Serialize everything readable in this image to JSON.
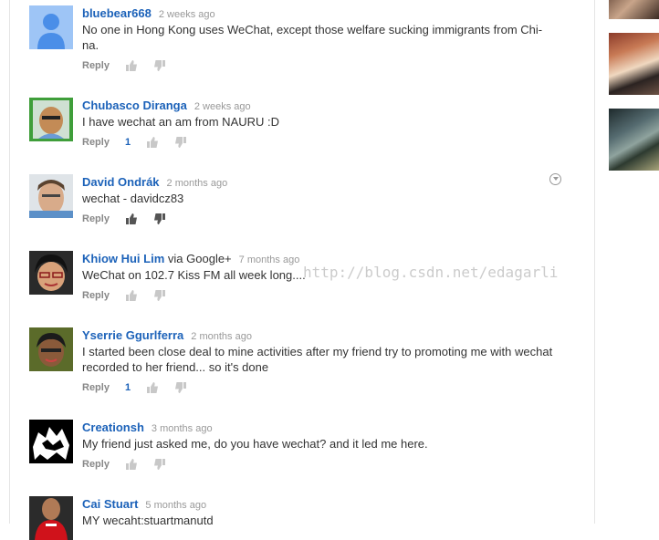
{
  "comments": [
    {
      "author": "bluebear668",
      "via": "",
      "time": "2 weeks ago",
      "text": "No one in Hong Kong uses WeChat, except those welfare sucking immigrants from Chi-na.",
      "reply": "Reply",
      "likes": ""
    },
    {
      "author": "Chubasco Diranga",
      "via": "",
      "time": "2 weeks ago",
      "text": "I have wechat an am from NAURU :D",
      "reply": "Reply",
      "likes": "1"
    },
    {
      "author": "David Ondrák",
      "via": "",
      "time": "2 months ago",
      "text": "wechat - davidcz83",
      "reply": "Reply",
      "likes": ""
    },
    {
      "author": "Khiow Hui Lim",
      "via": "via Google+",
      "time": "7 months ago",
      "text": "WeChat on 102.7 Kiss FM all week long....",
      "reply": "Reply",
      "likes": ""
    },
    {
      "author": "Yserrie Ggurlferra",
      "via": "",
      "time": "2 months ago",
      "text": "I started been close deal to mine activities after my friend try to promoting me with wechat recorded to her friend... so it's done",
      "reply": "Reply",
      "likes": "1"
    },
    {
      "author": "Creationsh",
      "via": "",
      "time": "3 months ago",
      "text": "My friend just asked me, do you have wechat? and it led me here.",
      "reply": "Reply",
      "likes": ""
    },
    {
      "author": "Cai Stuart",
      "via": "",
      "time": "5 months ago",
      "text": "MY wecaht:stuartmanutd",
      "reply": "Reply",
      "likes": ""
    }
  ],
  "watermark": "http://blog.csdn.net/edagarli",
  "colors": {
    "author": "#1c62b9",
    "text": "#333333",
    "muted": "#999999"
  }
}
